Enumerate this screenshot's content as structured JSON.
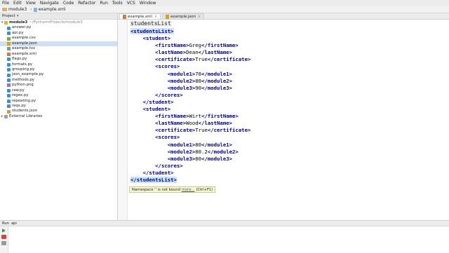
{
  "menu": [
    "File",
    "Edit",
    "View",
    "Navigate",
    "Code",
    "Refactor",
    "Run",
    "Tools",
    "VCS",
    "Window"
  ],
  "nav": {
    "project": "module3",
    "file": "example.xml"
  },
  "project_panel": {
    "title": "Project",
    "root": {
      "name": "module3",
      "path": "~/PycharmProjects/module3"
    },
    "files": [
      {
        "name": "answer.py",
        "kind": "py"
      },
      {
        "name": "api.py",
        "kind": "py"
      },
      {
        "name": "example.csv",
        "kind": "csv"
      },
      {
        "name": "example.json",
        "kind": "json",
        "selected": true
      },
      {
        "name": "example.tsv",
        "kind": "tsv"
      },
      {
        "name": "example.xml",
        "kind": "xml"
      },
      {
        "name": "flags.py",
        "kind": "py"
      },
      {
        "name": "formats.py",
        "kind": "py"
      },
      {
        "name": "grouping.py",
        "kind": "py"
      },
      {
        "name": "json_example.py",
        "kind": "py"
      },
      {
        "name": "methods.py",
        "kind": "py"
      },
      {
        "name": "python.png",
        "kind": "png"
      },
      {
        "name": "raw.py",
        "kind": "py"
      },
      {
        "name": "regex.py",
        "kind": "py"
      },
      {
        "name": "repeating.py",
        "kind": "py"
      },
      {
        "name": "reqs.py",
        "kind": "py"
      },
      {
        "name": "students.json",
        "kind": "json"
      }
    ],
    "external": "External Libraries"
  },
  "tabs": [
    {
      "label": "example.xml",
      "active": true
    },
    {
      "label": "example.json",
      "active": false
    }
  ],
  "editor": {
    "breadcrumb": "studentsList",
    "lines": [
      {
        "indent": 0,
        "open": "studentsList",
        "hl": true
      },
      {
        "indent": 1,
        "open": "student"
      },
      {
        "indent": 2,
        "open": "firstName",
        "text": "Greg",
        "close": "firstName"
      },
      {
        "indent": 2,
        "open": "lastName",
        "text": "Dean",
        "close": "lastName"
      },
      {
        "indent": 2,
        "open": "certificate",
        "text": "True",
        "close": "certificate"
      },
      {
        "indent": 2,
        "open": "scores"
      },
      {
        "indent": 3,
        "open": "module1",
        "text": "70",
        "close": "module1"
      },
      {
        "indent": 3,
        "open": "module2",
        "text": "80",
        "close": "module2"
      },
      {
        "indent": 3,
        "open": "module3",
        "text": "90",
        "close": "module3"
      },
      {
        "indent": 2,
        "close": "scores"
      },
      {
        "indent": 1,
        "close": "student"
      },
      {
        "indent": 1,
        "open": "student"
      },
      {
        "indent": 2,
        "open": "firstName",
        "text": "Wirt",
        "close": "firstName"
      },
      {
        "indent": 2,
        "open": "lastName",
        "text": "Wood",
        "close": "lastName"
      },
      {
        "indent": 2,
        "open": "certificate",
        "text": "True",
        "close": "certificate"
      },
      {
        "indent": 2,
        "open": "scores"
      },
      {
        "indent": 3,
        "open": "module1",
        "text": "80",
        "close": "module1"
      },
      {
        "indent": 3,
        "open": "module2",
        "text": "80.2",
        "close": "module2"
      },
      {
        "indent": 3,
        "open": "module3",
        "text": "80",
        "close": "module3"
      },
      {
        "indent": 2,
        "close": "scores"
      },
      {
        "indent": 1,
        "close": "student"
      },
      {
        "indent": 0,
        "close": "studentsList",
        "hl": true
      }
    ]
  },
  "tooltip": {
    "text": "Namespace '' is not bound",
    "link": "more...",
    "keys": "(Ctrl+F1)"
  },
  "run": {
    "label": "Run",
    "config": "api"
  }
}
